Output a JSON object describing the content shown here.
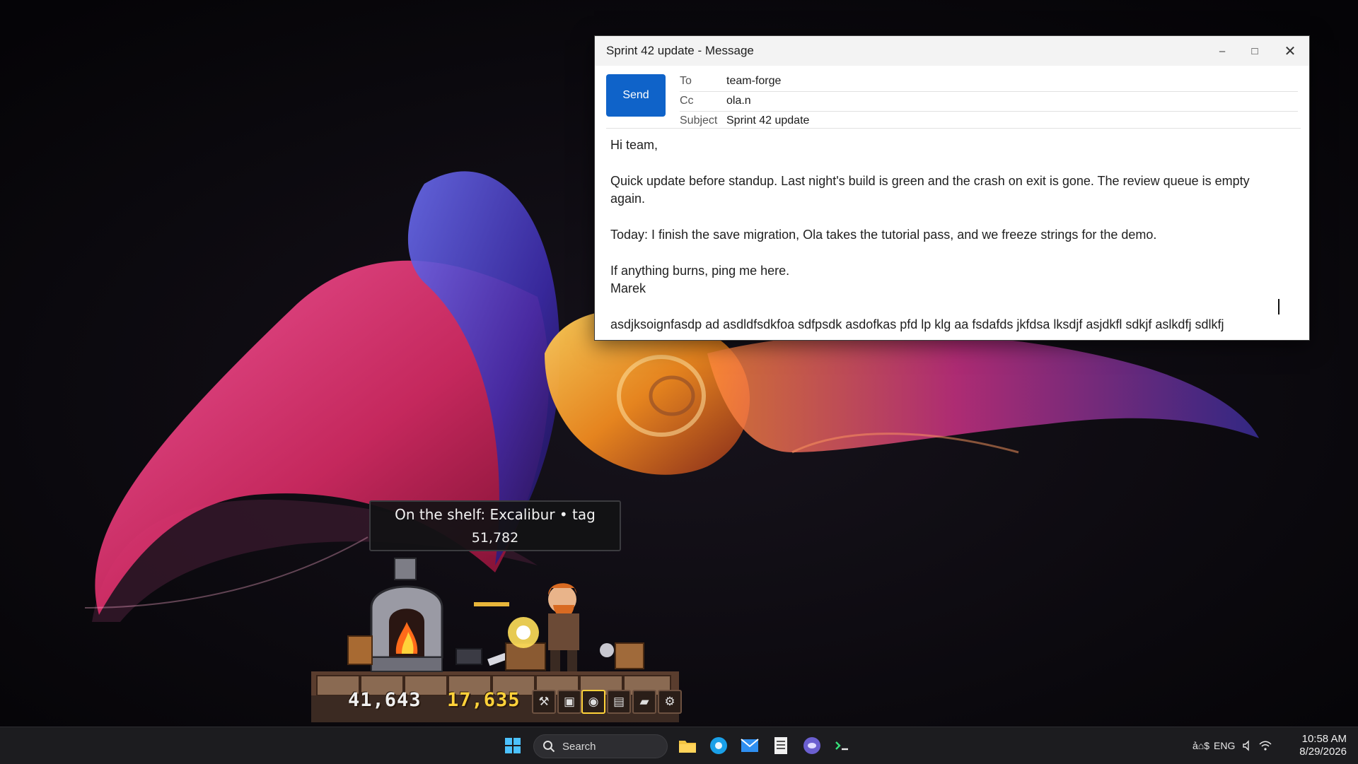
{
  "mail": {
    "window_title": "Sprint 42 update - Message",
    "minimize_glyph": "–",
    "maximize_glyph": "□",
    "close_glyph": "✕",
    "send_label": "Send",
    "to_label": "To",
    "to_value": "team-forge",
    "cc_label": "Cc",
    "cc_value": "ola.n",
    "subject_label": "Subject",
    "subject_value": "Sprint 42 update",
    "body": {
      "greeting": "Hi team,",
      "paragraph_1": "Quick update before standup. Last night's build is green and the crash on exit is gone. The review queue is empty again.",
      "paragraph_2": "Today: I finish the save migration, Ola takes the tutorial pass, and we freeze strings for the demo.",
      "paragraph_3": "If anything burns, ping me here.\nMarek",
      "typed_line": "asdjksoignfasdp ad asdldfsdkfoa sdfpsdk asdofkas pfd lp klg aa fsdafds jkfdsa lksdjf asjdkfl sdkjf aslkdfj sdlkfj"
    }
  },
  "game": {
    "tooltip_line1": "On the shelf: Excalibur • tag",
    "tooltip_line2": "51,782",
    "stone_count": "41,643",
    "gold_count": "17,635",
    "hud_icons": [
      "anvil-icon",
      "chest-icon",
      "shield-icon",
      "book-icon",
      "ingot-icon",
      "gear-icon"
    ]
  },
  "taskbar": {
    "search_label": "Search",
    "pinned_apps": [
      "file-explorer-icon",
      "browser-icon",
      "mail-icon",
      "notepad-icon",
      "chat-icon",
      "terminal-icon"
    ],
    "ime_label": "ả⌂$",
    "language": "ENG",
    "time": "10:58 AM",
    "date": "8/29/2026"
  },
  "colors": {
    "send_button": "#0f63c9",
    "taskbar": "#1c1c1f",
    "hud_gold": "#ffd23a"
  }
}
